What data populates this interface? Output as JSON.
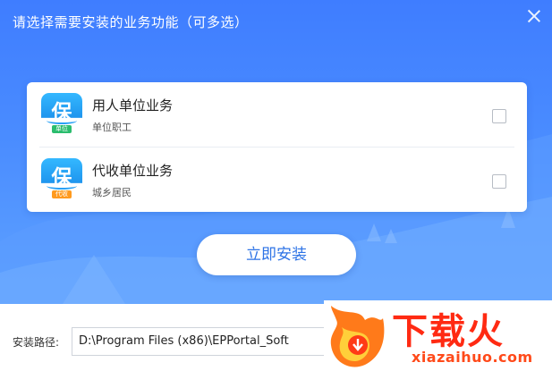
{
  "window": {
    "title": "请选择需要安装的业务功能（可多选）"
  },
  "options": [
    {
      "name": "用人单位业务",
      "subtitle": "单位职工",
      "icon_glyph": "保",
      "icon_tag": "单位",
      "checked": false
    },
    {
      "name": "代收单位业务",
      "subtitle": "城乡居民",
      "icon_glyph": "保",
      "icon_tag": "代收",
      "checked": false
    }
  ],
  "install_button": {
    "label": "立即安装"
  },
  "install_path": {
    "label": "安装路径:",
    "value": "D:\\Program Files (x86)\\EPPortal_Soft"
  },
  "watermark": {
    "brand_text": "下载火",
    "site_text": "xiazaihuo.com"
  },
  "colors": {
    "primary": "#3f7dff",
    "button_text": "#2d73e6",
    "tag_green": "#2bbd6e",
    "tag_orange": "#ff9a1e",
    "watermark": "#ff2a12"
  }
}
